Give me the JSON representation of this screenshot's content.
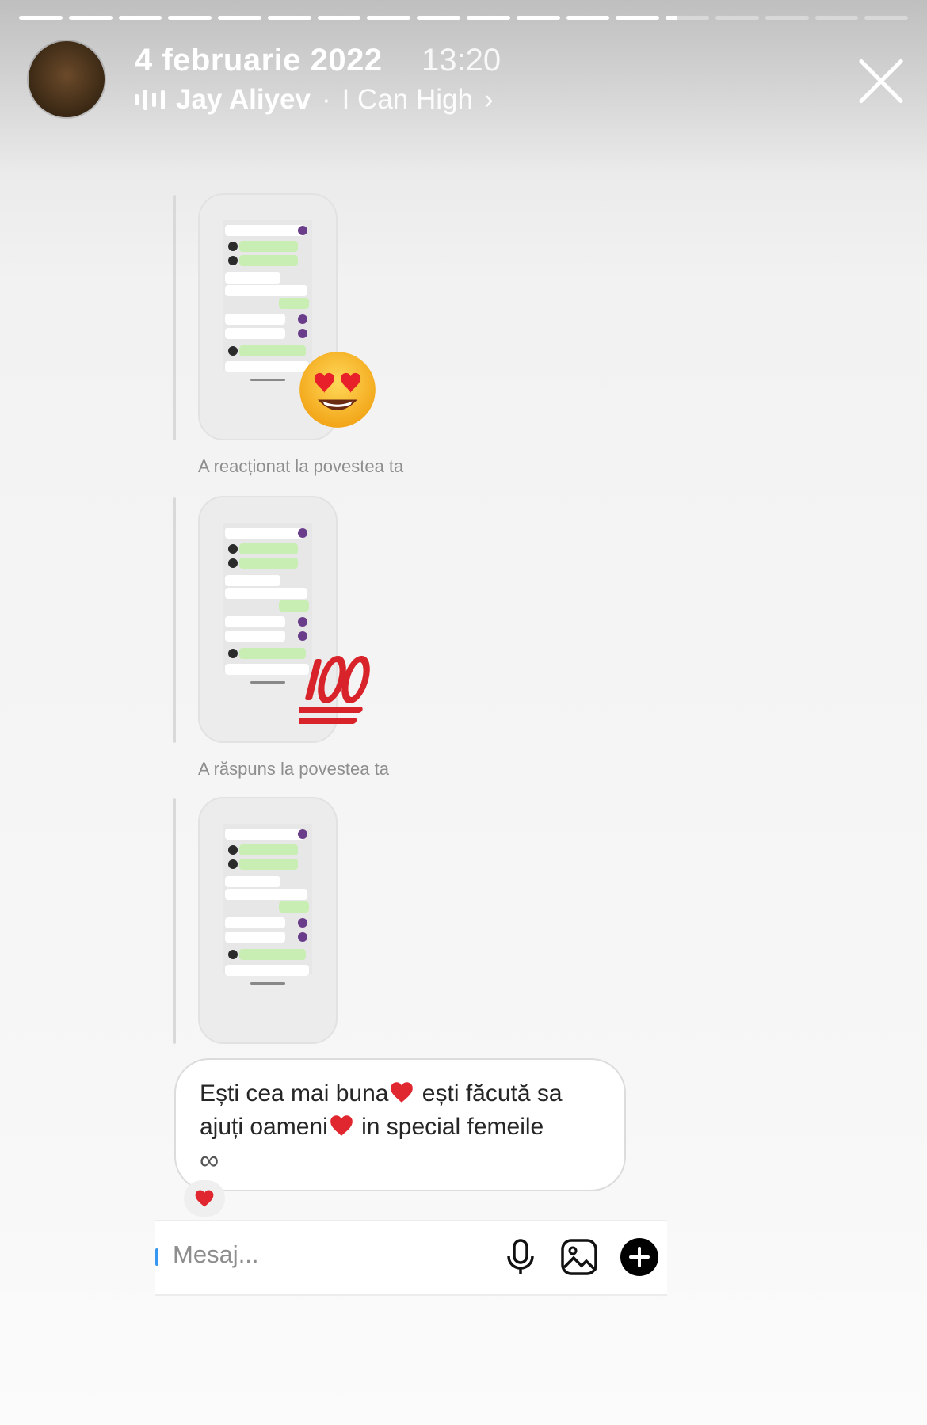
{
  "story": {
    "progress_segments_total": 18,
    "progress_segments_complete": 13,
    "progress_current_fraction": 0.25
  },
  "header": {
    "date": "4 februarie 2022",
    "time": "13:20",
    "music": {
      "artist": "Jay Aliyev",
      "separator": "·",
      "song": "I Can High",
      "chevron": "›"
    }
  },
  "posts": [
    {
      "caption": "A reacționat la povestea ta",
      "reaction": "😍"
    },
    {
      "caption": "A răspuns la povestea ta",
      "reaction": "💯"
    },
    {
      "caption": "",
      "reaction": ""
    }
  ],
  "message": {
    "line1a": "Ești cea mai buna",
    "line1b": " ești făcută sa",
    "line2a": "ajuți oameni",
    "line2b": " in special femeile",
    "line3": "∞",
    "reaction": "heart"
  },
  "composer": {
    "placeholder": "Mesaj...",
    "icons": [
      "microphone-icon",
      "gallery-icon",
      "plus-icon"
    ]
  },
  "colors": {
    "heart": "#e0262e",
    "bubble_green": "#c9eeb4",
    "caption": "#8e8e8e"
  }
}
